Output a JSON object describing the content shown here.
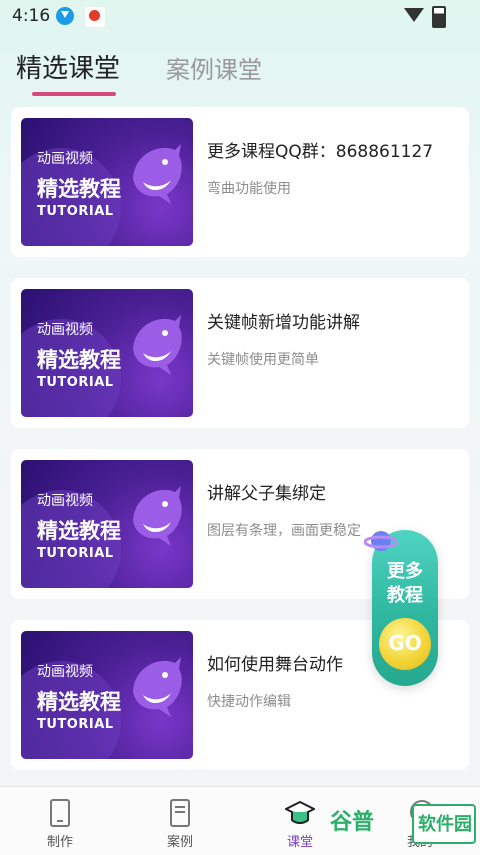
{
  "status_bar": {
    "time": "4:16"
  },
  "tabs": [
    {
      "label": "精选课堂",
      "active": true
    },
    {
      "label": "案例课堂",
      "active": false
    }
  ],
  "cards": [
    {
      "thumb": {
        "line1": "动画视频",
        "line2": "精选教程",
        "line3": "TUTORIAL"
      },
      "title": "更多课程QQ群：868861127",
      "subtitle": "弯曲功能使用"
    },
    {
      "thumb": {
        "line1": "动画视频",
        "line2": "精选教程",
        "line3": "TUTORIAL"
      },
      "title": "关键帧新增功能讲解",
      "subtitle": "关键帧使用更简单"
    },
    {
      "thumb": {
        "line1": "动画视频",
        "line2": "精选教程",
        "line3": "TUTORIAL"
      },
      "title": "讲解父子集绑定",
      "subtitle": "图层有条理，画面更稳定"
    },
    {
      "thumb": {
        "line1": "动画视频",
        "line2": "精选教程",
        "line3": "TUTORIAL"
      },
      "title": "如何使用舞台动作",
      "subtitle": "快捷动作编辑"
    }
  ],
  "floating_button": {
    "line1": "更多",
    "line2": "教程",
    "go": "GO"
  },
  "bottom_nav": [
    {
      "label": "制作",
      "icon": "phone-icon",
      "active": false
    },
    {
      "label": "案例",
      "icon": "document-icon",
      "active": false
    },
    {
      "label": "课堂",
      "icon": "graduation-cap-icon",
      "active": true
    },
    {
      "label": "我的",
      "icon": "user-icon",
      "active": false
    }
  ],
  "watermark": {
    "text": "谷普",
    "box": "软件园"
  },
  "colors": {
    "accent": "#7b3fd0",
    "tab_underline": "#d64b7d",
    "float_button": "#2fb79f",
    "go_button": "#f2d537"
  }
}
